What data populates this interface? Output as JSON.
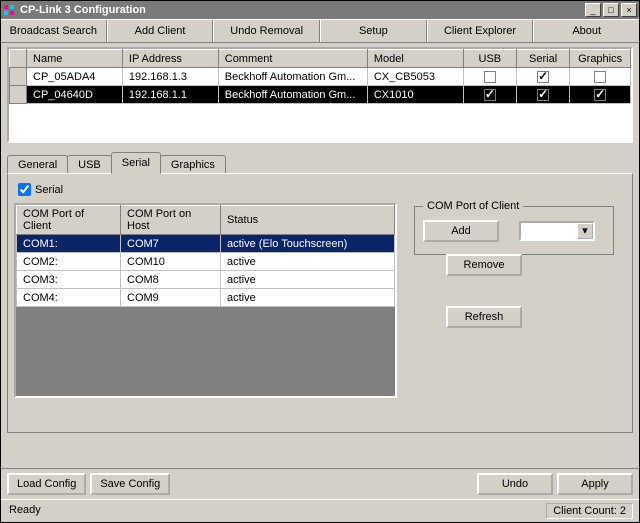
{
  "title": "CP-Link 3 Configuration",
  "toolbar": {
    "broadcast": "Broadcast Search",
    "add_client": "Add Client",
    "undo_removal": "Undo Removal",
    "setup": "Setup",
    "client_explorer": "Client Explorer",
    "about": "About"
  },
  "clients": {
    "columns": {
      "name": "Name",
      "ip": "IP Address",
      "comment": "Comment",
      "model": "Model",
      "usb": "USB",
      "serial": "Serial",
      "graphics": "Graphics"
    },
    "rows": [
      {
        "name": "CP_05ADA4",
        "ip": "192.168.1.3",
        "comment": "Beckhoff Automation Gm...",
        "model": "CX_CB5053",
        "usb": false,
        "serial": true,
        "graphics": false,
        "selected": false
      },
      {
        "name": "CP_04640D",
        "ip": "192.168.1.1",
        "comment": "Beckhoff Automation Gm...",
        "model": "CX1010",
        "usb": true,
        "serial": true,
        "graphics": true,
        "selected": true
      }
    ]
  },
  "tabs": {
    "general": "General",
    "usb": "USB",
    "serial": "Serial",
    "graphics": "Graphics",
    "active": "serial"
  },
  "serial_tab": {
    "checkbox_label": "Serial",
    "checkbox_checked": true,
    "columns": {
      "client": "COM Port of Client",
      "host": "COM Port on Host",
      "status": "Status"
    },
    "rows": [
      {
        "client": "COM1:",
        "host": "COM7",
        "status": "active (Elo Touchscreen)",
        "hl": true
      },
      {
        "client": "COM2:",
        "host": "COM10",
        "status": "active",
        "hl": false
      },
      {
        "client": "COM3:",
        "host": "COM8",
        "status": "active",
        "hl": false
      },
      {
        "client": "COM4:",
        "host": "COM9",
        "status": "active",
        "hl": false
      }
    ],
    "group": {
      "legend": "COM Port of Client",
      "add": "Add",
      "remove": "Remove",
      "refresh": "Refresh"
    }
  },
  "bottom": {
    "load": "Load Config",
    "save": "Save Config",
    "undo": "Undo",
    "apply": "Apply"
  },
  "status": {
    "ready": "Ready",
    "count": "Client Count: 2"
  }
}
